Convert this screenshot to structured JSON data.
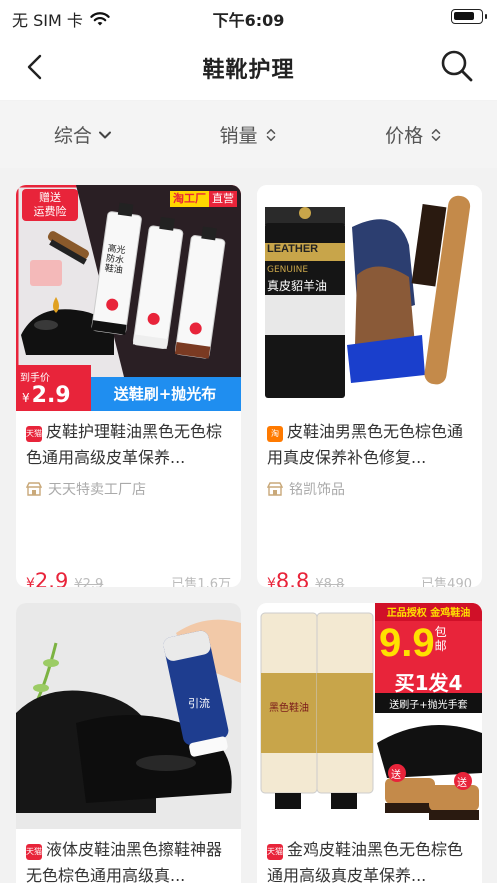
{
  "status": {
    "carrier": "无 SIM 卡",
    "time": "下午6:09",
    "battery_level": 0.8
  },
  "nav": {
    "title": "鞋靴护理",
    "back_icon": "chevron-left-icon",
    "search_icon": "search-icon"
  },
  "sort": {
    "items": [
      {
        "label": "综合",
        "icon": "chevron-down-icon"
      },
      {
        "label": "销量",
        "icon": "sort-updown-icon"
      },
      {
        "label": "价格",
        "icon": "sort-updown-icon"
      }
    ]
  },
  "products": [
    {
      "platform": "天猫",
      "platform_color": "#e8243a",
      "title": "皮鞋护理鞋油黑色无色棕色通用高级皮革保养...",
      "shop": "天天特卖工厂店",
      "price_currency": "¥",
      "price": "2.9",
      "orig_price": "¥2.9",
      "sold": "已售1.6万",
      "img": {
        "badge_gift": "赠送",
        "badge_insure": "运费险",
        "badge_factory": "淘工厂",
        "badge_direct": "直营",
        "tube_text": "高光防水鞋油",
        "hand_price_label": "到手价",
        "hand_price_currency": "¥",
        "hand_price": "2.9",
        "promo": "送鞋刷+抛光布"
      }
    },
    {
      "platform": "淘",
      "platform_color": "#ff7a00",
      "title": "皮鞋油男黑色无色棕色通用真皮保养补色修复...",
      "shop": "铭凯饰品",
      "price_currency": "¥",
      "price": "8.8",
      "orig_price": "¥8.8",
      "sold": "已售490",
      "img": {
        "brand": "LEATHER",
        "genuine": "GENUINE",
        "tube_text": "真皮貂羊油"
      }
    },
    {
      "platform": "天猫",
      "platform_color": "#e8243a",
      "title": "液体皮鞋油黑色擦鞋神器无色棕色通用高级真...",
      "img": {
        "bottle_text": "引流"
      }
    },
    {
      "platform": "天猫",
      "platform_color": "#e8243a",
      "title": "金鸡皮鞋油黑色无色棕色通用高级真皮革保养...",
      "img": {
        "banner_top": "正品授权 金鸡鞋油",
        "big_price": "9.9",
        "big_price_suffix": "包邮",
        "buy_offer": "买1发4",
        "gift_line": "送刷子+抛光手套",
        "tube_text": "黑色鞋油",
        "gift_tag_1": "送",
        "gift_tag_2": "送"
      }
    }
  ]
}
